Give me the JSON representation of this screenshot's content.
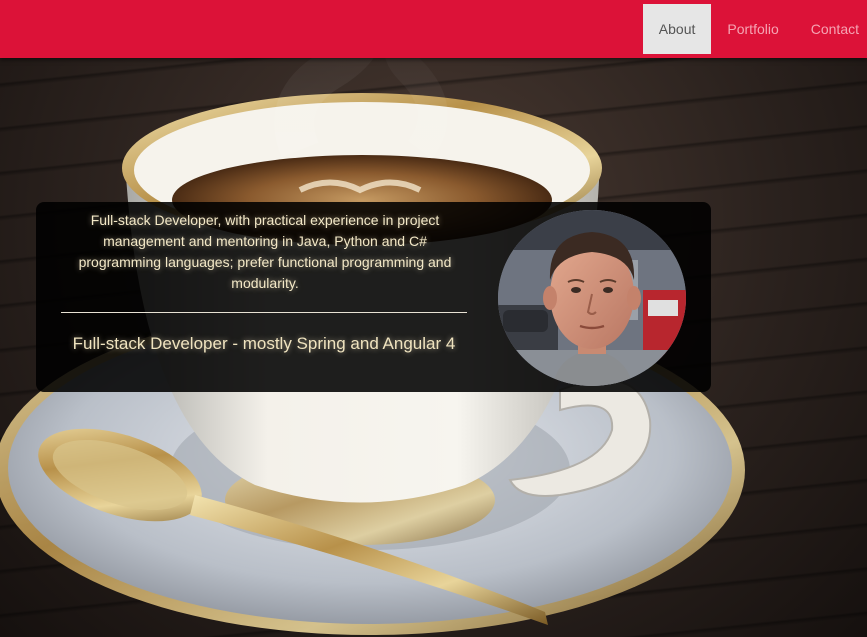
{
  "nav": {
    "items": [
      {
        "label": "About",
        "active": true
      },
      {
        "label": "Portfolio",
        "active": false
      },
      {
        "label": "Contact",
        "active": false
      }
    ]
  },
  "profile": {
    "description": "Full-stack Developer, with practical experience in project management and mentoring in Java, Python and C# programming languages; prefer functional programming and modularity.",
    "role": "Full-stack Developer - mostly Spring and Angular 4",
    "avatar_icon": "profile-photo-avatar"
  },
  "colors": {
    "navbar": "#dc1238",
    "active_tab_bg": "#e6e6e6",
    "text": "#f3e8c7"
  }
}
